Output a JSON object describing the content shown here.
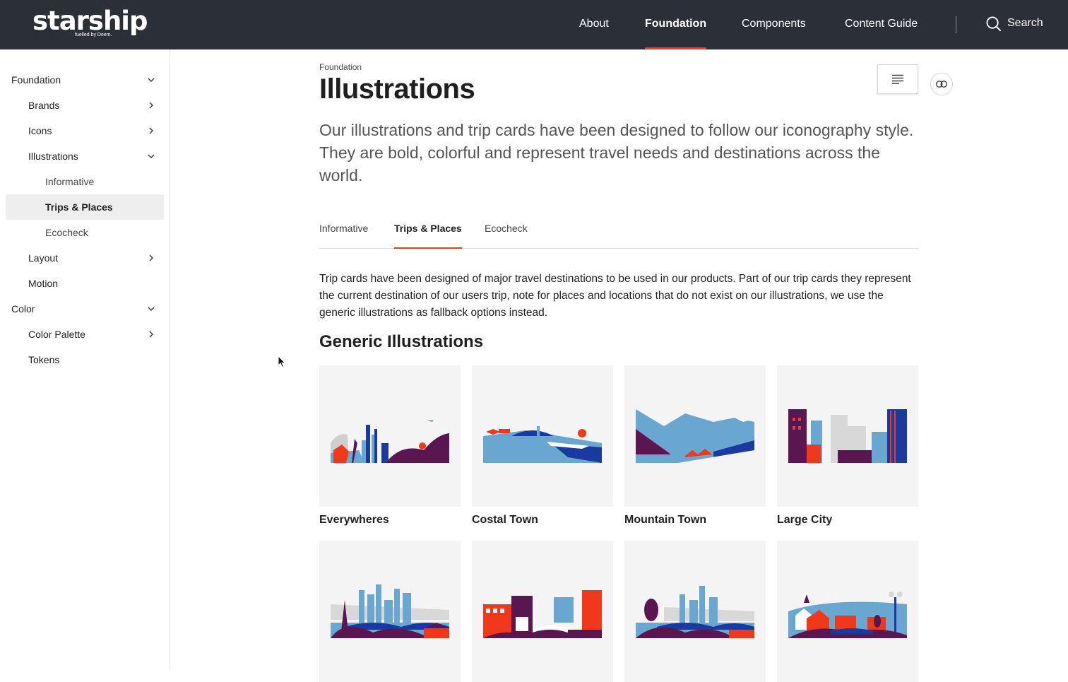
{
  "header": {
    "logo_word": "starship",
    "logo_sub": "fuelled by Deem.",
    "nav": [
      "About",
      "Foundation",
      "Components",
      "Content Guide"
    ],
    "active_nav": "Foundation",
    "search_label": "Search"
  },
  "sidebar": {
    "items": [
      {
        "label": "Foundation",
        "chevron": "down"
      },
      {
        "label": "Brands",
        "chevron": "right"
      },
      {
        "label": "Icons",
        "chevron": "right"
      },
      {
        "label": "Illustrations",
        "chevron": "down"
      },
      {
        "label": "Informative",
        "chevron": ""
      },
      {
        "label": "Trips & Places",
        "chevron": "",
        "selected": true
      },
      {
        "label": "Ecocheck",
        "chevron": ""
      },
      {
        "label": "Layout",
        "chevron": "right"
      },
      {
        "label": "Motion",
        "chevron": ""
      },
      {
        "label": "Color",
        "chevron": "down"
      },
      {
        "label": "Color Palette",
        "chevron": "right"
      },
      {
        "label": "Tokens",
        "chevron": ""
      }
    ]
  },
  "main": {
    "breadcrumb": "Foundation",
    "title": "Illustrations",
    "lede": "Our illustrations and trip cards have been designed to follow our iconography style. They are bold, colorful and represent travel needs and destinations across the world.",
    "tabs": [
      "Informative",
      "Trips & Places",
      "Ecocheck"
    ],
    "active_tab": "Trips & Places",
    "body": "Trip cards have been designed of major travel destinations to be used in our products. Part of our trip cards they represent the current destination of our users trip, note for places and locations that do not exist on our illustrations, we use the generic illustrations as fallback options instead.",
    "section_title": "Generic Illustrations",
    "cards": [
      {
        "label": "Everywheres"
      },
      {
        "label": "Costal Town"
      },
      {
        "label": "Mountain Town"
      },
      {
        "label": "Large City"
      },
      {
        "label": ""
      },
      {
        "label": ""
      },
      {
        "label": ""
      },
      {
        "label": ""
      }
    ]
  },
  "colors": {
    "topbar": "#2b3038",
    "accent": "#e8401c",
    "illustration_blue": "#6aa7d0",
    "illustration_navy": "#1a3aa0",
    "illustration_purple": "#5a1650",
    "illustration_red": "#f0381a"
  }
}
